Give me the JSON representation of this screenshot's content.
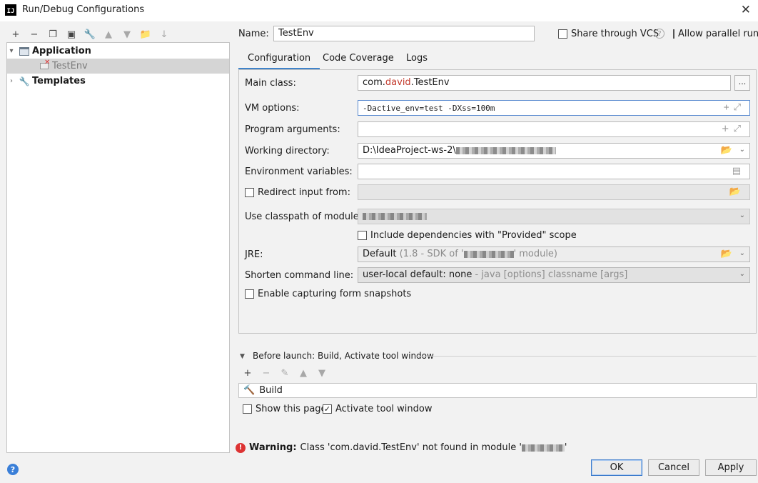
{
  "window": {
    "title": "Run/Debug Configurations",
    "app_logo": "IJ",
    "close": "✕"
  },
  "toolbar": {
    "icons": [
      {
        "name": "add-icon",
        "glyph": "+",
        "dim": false
      },
      {
        "name": "remove-icon",
        "glyph": "−",
        "dim": false
      },
      {
        "name": "copy-icon",
        "glyph": "❐",
        "dim": false
      },
      {
        "name": "save-icon",
        "glyph": "▣",
        "dim": false
      },
      {
        "name": "wrench-icon",
        "glyph": "🔧",
        "dim": false
      },
      {
        "name": "move-up-icon",
        "glyph": "▲",
        "dim": true
      },
      {
        "name": "move-down-icon",
        "glyph": "▼",
        "dim": true
      },
      {
        "name": "folder-add-icon",
        "glyph": "📁",
        "dim": false
      },
      {
        "name": "sort-icon",
        "glyph": "↓",
        "dim": true
      }
    ]
  },
  "tree": {
    "application": "Application",
    "testenv": "TestEnv",
    "templates": "Templates"
  },
  "header": {
    "name_label": "Name:",
    "name_value": "TestEnv",
    "share_label": "Share through VCS",
    "allow_parallel_label": "Allow parallel run",
    "help": "?"
  },
  "tabs": [
    "Configuration",
    "Code Coverage",
    "Logs"
  ],
  "config": {
    "main_class_label": "Main class:",
    "main_class_pre": "com.",
    "main_class_red": "david",
    "main_class_post": ".TestEnv",
    "main_class_button": "...",
    "vm_label": "VM options:",
    "vm_value": "-Dactive_env=test -DXss=100m",
    "program_args_label": "Program arguments:",
    "workdir_label": "Working directory:",
    "workdir_value": "D:\\IdeaProject-ws-2\\",
    "env_label": "Environment variables:",
    "redirect_label": "Redirect input from:",
    "classpath_label": "Use classpath of module:",
    "include_deps_label": "Include dependencies with \"Provided\" scope",
    "jre_label": "JRE:",
    "jre_value": "Default",
    "jre_hint_pre": "(1.8 - SDK of '",
    "jre_hint_post": "' module)",
    "shorten_label": "Shorten command line:",
    "shorten_value": "user-local default: none",
    "shorten_hint": "- java [options] classname [args]",
    "snapshots_label": "Enable capturing form snapshots"
  },
  "before_launch": {
    "title": "Before launch: Build, Activate tool window",
    "toolbar": [
      {
        "name": "add-task-icon",
        "glyph": "+",
        "dim": false
      },
      {
        "name": "remove-task-icon",
        "glyph": "−",
        "dim": true
      },
      {
        "name": "edit-task-icon",
        "glyph": "✎",
        "dim": true
      },
      {
        "name": "task-up-icon",
        "glyph": "▲",
        "dim": true
      },
      {
        "name": "task-down-icon",
        "glyph": "▼",
        "dim": true
      }
    ],
    "build_item": "Build",
    "show_page_label": "Show this page",
    "activate_label": "Activate tool window"
  },
  "warning": {
    "label": "Warning:",
    "text_pre": "Class 'com.david.TestEnv' not found in module '",
    "text_post": "'"
  },
  "buttons": {
    "ok": "OK",
    "cancel": "Cancel",
    "apply": "Apply",
    "help": "?"
  }
}
